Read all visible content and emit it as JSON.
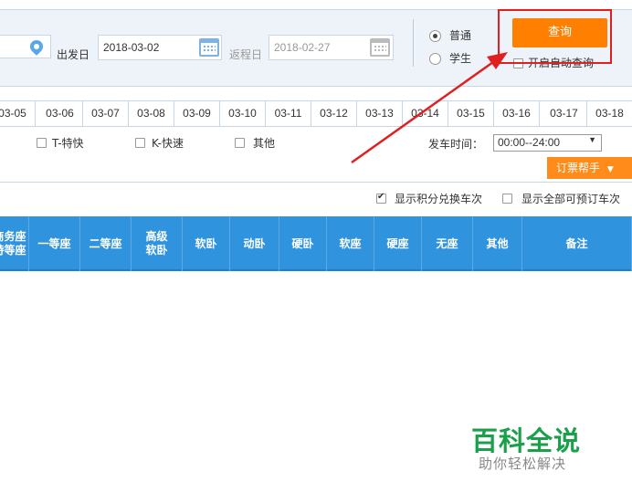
{
  "search": {
    "depart_label": "出发日",
    "depart_date": "2018-03-02",
    "return_label": "返程日",
    "return_date": "2018-02-27",
    "ticket_type": [
      {
        "label": "普通",
        "selected": true
      },
      {
        "label": "学生",
        "selected": false
      }
    ],
    "query_button": "查询",
    "auto_query_label": "开启自动查询",
    "auto_query_checked": false
  },
  "date_strip": [
    "03-05",
    "03-06",
    "03-07",
    "03-08",
    "03-09",
    "03-10",
    "03-11",
    "03-12",
    "03-13",
    "03-14",
    "03-15",
    "03-16",
    "03-17",
    "03-18"
  ],
  "filters": {
    "train_types": [
      "T-特快",
      "K-快速",
      "其他"
    ],
    "depart_time_label": "发车时间：",
    "depart_time_value": "00:00--24:00",
    "help_button": "订票帮手"
  },
  "options": {
    "points_label": "显示积分兑换车次",
    "points_checked": true,
    "all_bookable_label": "显示全部可预订车次",
    "all_bookable_checked": false
  },
  "table_headers": [
    "商务座\n特等座",
    "一等座",
    "二等座",
    "高级\n软卧",
    "软卧",
    "动卧",
    "硬卧",
    "软座",
    "硬座",
    "无座",
    "其他",
    "备注"
  ],
  "watermark": {
    "title": "百科全说",
    "subtitle": "助你轻松解决"
  },
  "colors": {
    "accent_orange": "#ff8000",
    "header_blue": "#2f93de",
    "highlight_red": "#e02020",
    "watermark_green": "#1aa04a"
  }
}
